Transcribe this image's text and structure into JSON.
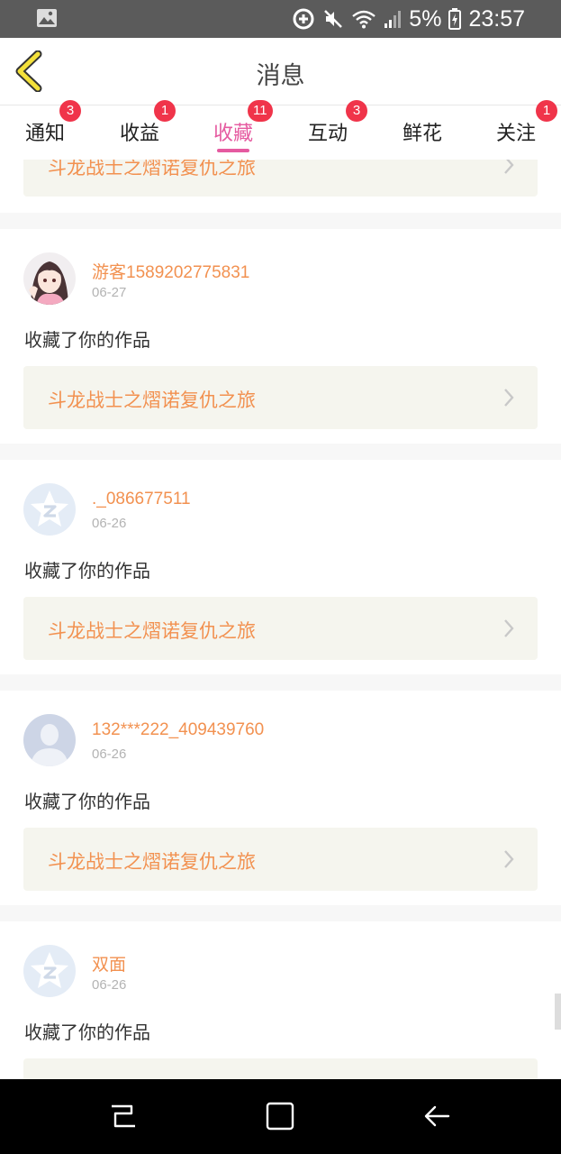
{
  "status_bar": {
    "battery": "5%",
    "time": "23:57"
  },
  "header": {
    "title": "消息"
  },
  "tabs": [
    {
      "label": "通知",
      "badge": "3"
    },
    {
      "label": "收益",
      "badge": "1"
    },
    {
      "label": "收藏",
      "badge": "11",
      "active": true
    },
    {
      "label": "互动",
      "badge": "3"
    },
    {
      "label": "鲜花",
      "badge": ""
    },
    {
      "label": "关注",
      "badge": "1"
    }
  ],
  "colors": {
    "accent": "#e55aa0",
    "badge": "#f0344a",
    "username": "#f29150",
    "work_bg": "#f5f5ee"
  },
  "partial_top_card": {
    "work_title": "斗龙战士之熠诺复仇之旅"
  },
  "messages": [
    {
      "user": "游客1589202775831",
      "date": "06-27",
      "action": "收藏了你的作品",
      "work_title": "斗龙战士之熠诺复仇之旅",
      "avatar": "anime-girl-avatar"
    },
    {
      "user": "._086677511",
      "date": "06-26",
      "action": "收藏了你的作品",
      "work_title": "斗龙战士之熠诺复仇之旅",
      "avatar": "qq-star-avatar"
    },
    {
      "user": "132***222_409439760",
      "date": "06-26",
      "action": "收藏了你的作品",
      "work_title": "斗龙战士之熠诺复仇之旅",
      "avatar": "default-person-avatar"
    },
    {
      "user": "双面",
      "date": "06-26",
      "action": "收藏了你的作品",
      "work_title": "",
      "avatar": "qq-star-avatar"
    }
  ]
}
